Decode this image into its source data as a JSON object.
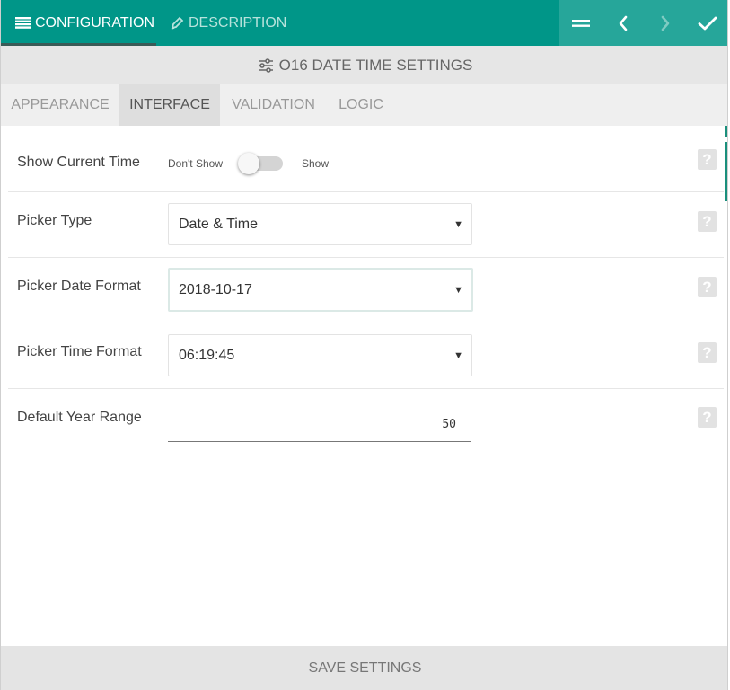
{
  "top_tabs": [
    {
      "label": "CONFIGURATION",
      "icon": "list-icon"
    },
    {
      "label": "DESCRIPTION",
      "icon": "pen-icon"
    }
  ],
  "actions": [
    "menu-icon",
    "chevron-left-icon",
    "chevron-right-icon",
    "check-icon"
  ],
  "title": "O16 DATE TIME SETTINGS",
  "title_icon": "sliders-icon",
  "tabs": [
    "APPEARANCE",
    "INTERFACE",
    "VALIDATION",
    "LOGIC"
  ],
  "active_tab": "INTERFACE",
  "fields": {
    "show_current_time": {
      "label": "Show Current Time",
      "off_label": "Don't Show",
      "on_label": "Show",
      "value": false
    },
    "picker_type": {
      "label": "Picker Type",
      "value": "Date & Time"
    },
    "picker_date_format": {
      "label": "Picker Date Format",
      "value": "2018-10-17"
    },
    "picker_time_format": {
      "label": "Picker Time Format",
      "value": "06:19:45"
    },
    "default_year_range": {
      "label": "Default Year Range",
      "value": "50"
    }
  },
  "help_symbol": "?",
  "save_label": "SAVE SETTINGS",
  "colors": {
    "primary": "#009688",
    "primary_light": "#26a69a",
    "title_bg": "#e6e6e6",
    "tabs_bg": "#efefef"
  }
}
